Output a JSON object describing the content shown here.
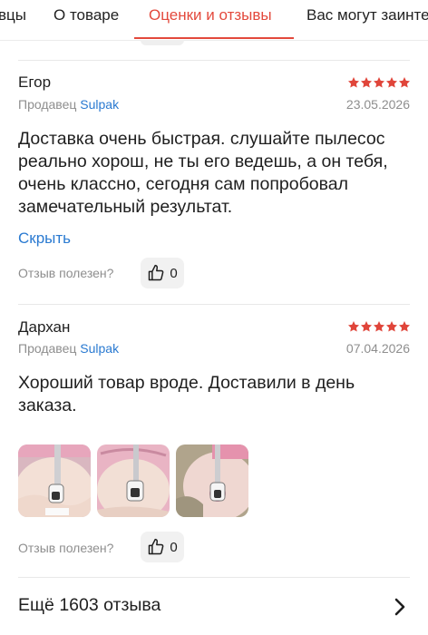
{
  "tabs": [
    {
      "label": "вцы"
    },
    {
      "label": "О товаре"
    },
    {
      "label": "Оценки и отзывы",
      "active": true
    },
    {
      "label": "Вас могут заинте"
    }
  ],
  "reviews": [
    {
      "author": "Егор",
      "rating": 5,
      "seller_prefix": "Продавец",
      "seller_name": "Sulpak",
      "date": "23.05.2026",
      "text": "Доставка очень быстрая. слушайте пылесос реально хорош, не ты его ведешь, а он тебя, очень классно, сегодня сам попробовал замечательный результат.",
      "hide_label": "Скрыть",
      "helpful_question": "Отзыв полезен?",
      "likes": "0"
    },
    {
      "author": "Дархан",
      "rating": 5,
      "seller_prefix": "Продавец",
      "seller_name": "Sulpak",
      "date": "07.04.2026",
      "text": "Хороший товар вроде. Доставили в день заказа.",
      "photos": [
        "photo-1",
        "photo-2",
        "photo-3"
      ],
      "helpful_question": "Отзыв полезен?",
      "likes": "0"
    }
  ],
  "more_reviews": {
    "label": "Ещё 1603 отзыва",
    "icon": "chevron-right-icon"
  },
  "colors": {
    "accent": "#e3493c",
    "link": "#2a7ad1",
    "star": "#e0453a",
    "muted": "#8e8e8e"
  }
}
